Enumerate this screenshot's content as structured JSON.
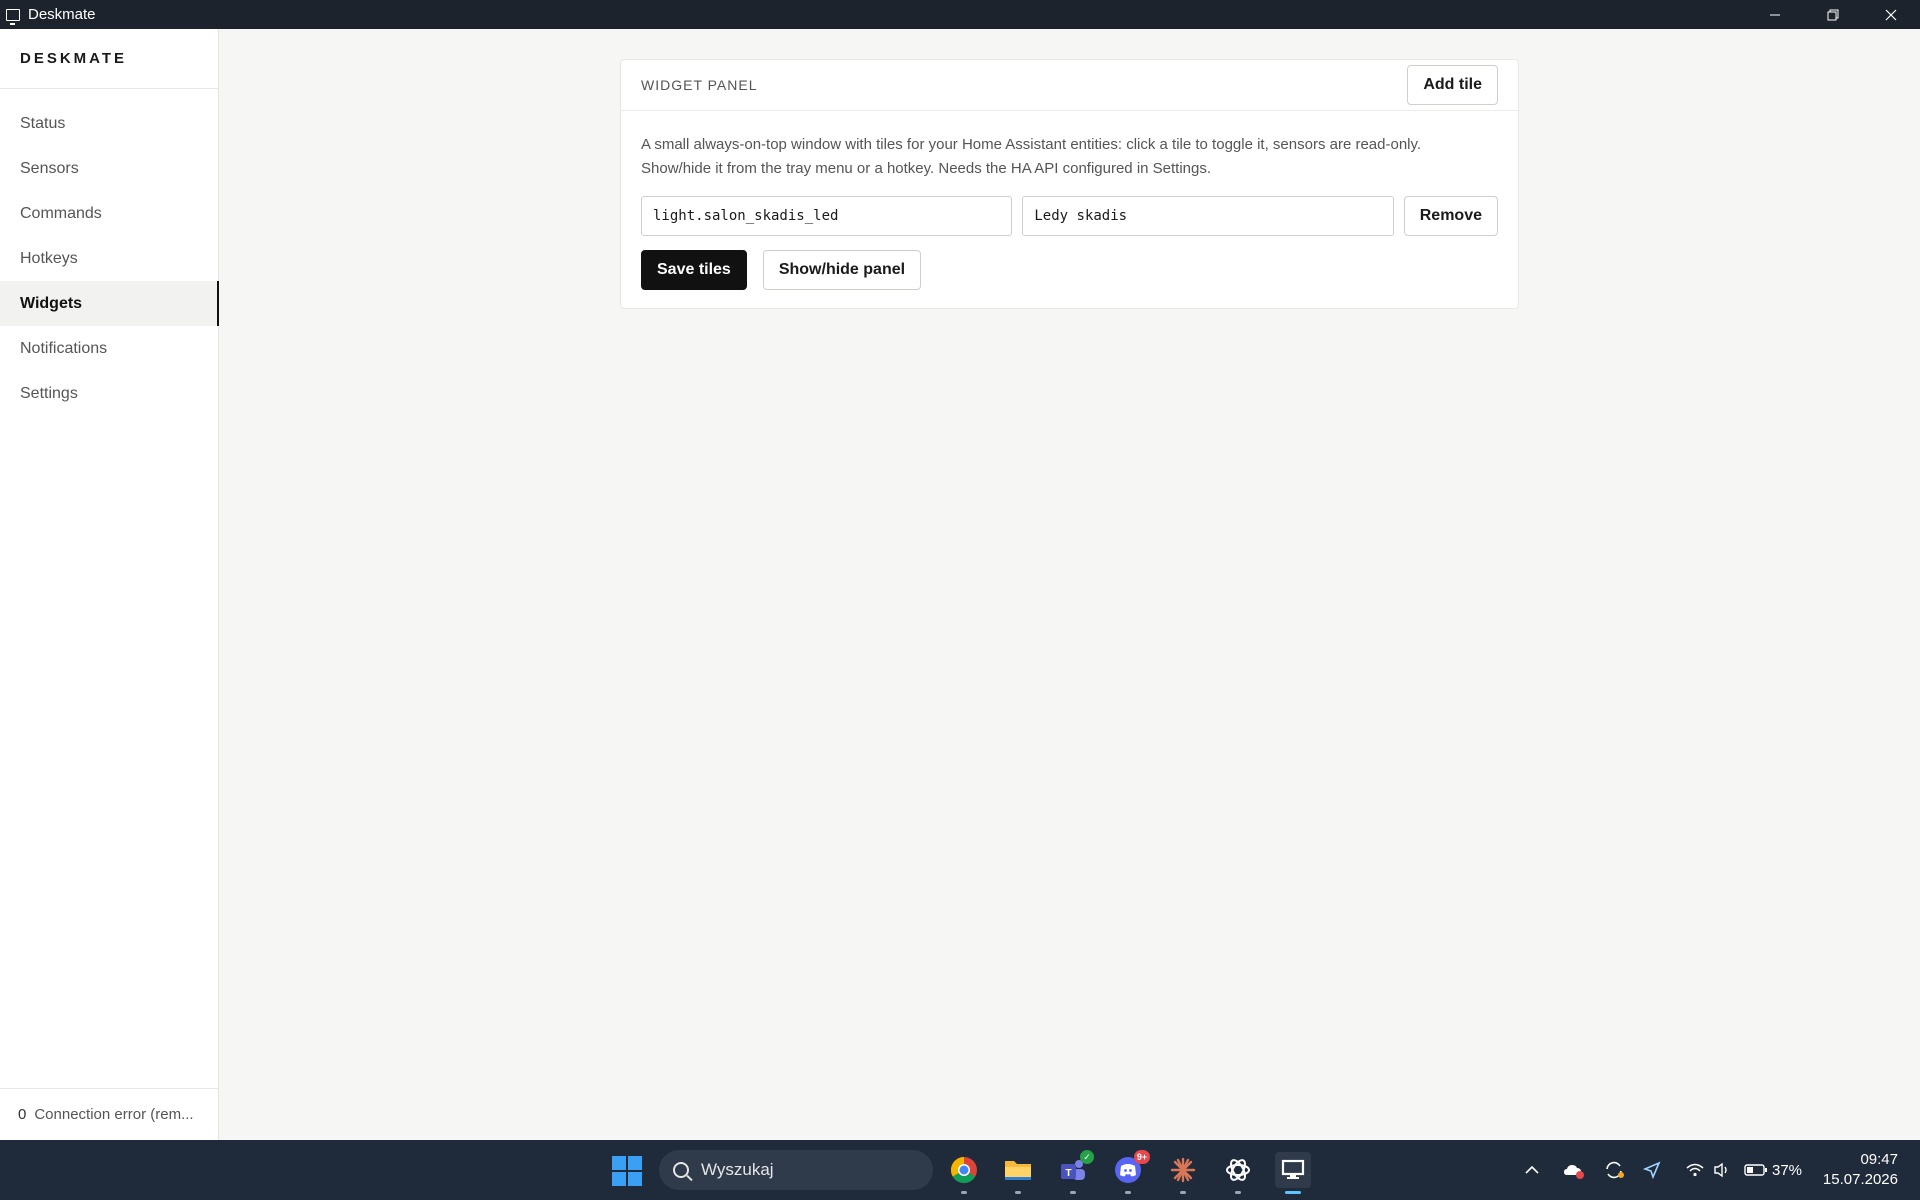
{
  "window": {
    "title": "Deskmate"
  },
  "sidebar": {
    "brand": "DESKMATE",
    "items": [
      {
        "label": "Status",
        "active": false
      },
      {
        "label": "Sensors",
        "active": false
      },
      {
        "label": "Commands",
        "active": false
      },
      {
        "label": "Hotkeys",
        "active": false
      },
      {
        "label": "Widgets",
        "active": true
      },
      {
        "label": "Notifications",
        "active": false
      },
      {
        "label": "Settings",
        "active": false
      }
    ],
    "footer": {
      "indicator": "0",
      "status": "Connection error (rem..."
    }
  },
  "panel": {
    "title": "WIDGET PANEL",
    "add_tile_label": "Add tile",
    "description_line1": "A small always-on-top window with tiles for your Home Assistant entities: click a tile to toggle it, sensors are read-only.",
    "description_line2": "Show/hide it from the tray menu or a hotkey. Needs the HA API configured in Settings.",
    "tiles": [
      {
        "entity": "light.salon_skadis_led",
        "name": "Ledy skadis",
        "remove_label": "Remove"
      }
    ],
    "save_label": "Save tiles",
    "toggle_label": "Show/hide panel"
  },
  "taskbar": {
    "search_placeholder": "Wyszukaj",
    "apps": [
      "chrome-icon",
      "file-explorer-icon",
      "teams-icon",
      "discord-icon",
      "claude-icon",
      "chatgpt-icon",
      "deskmate-icon"
    ],
    "discord_badge": "9+",
    "battery": "37%",
    "time": "09:47",
    "date": "15.07.2026"
  },
  "colors": {
    "accent": "#111111",
    "taskbar": "#1f2a3a",
    "titlebar": "#1c232d"
  }
}
